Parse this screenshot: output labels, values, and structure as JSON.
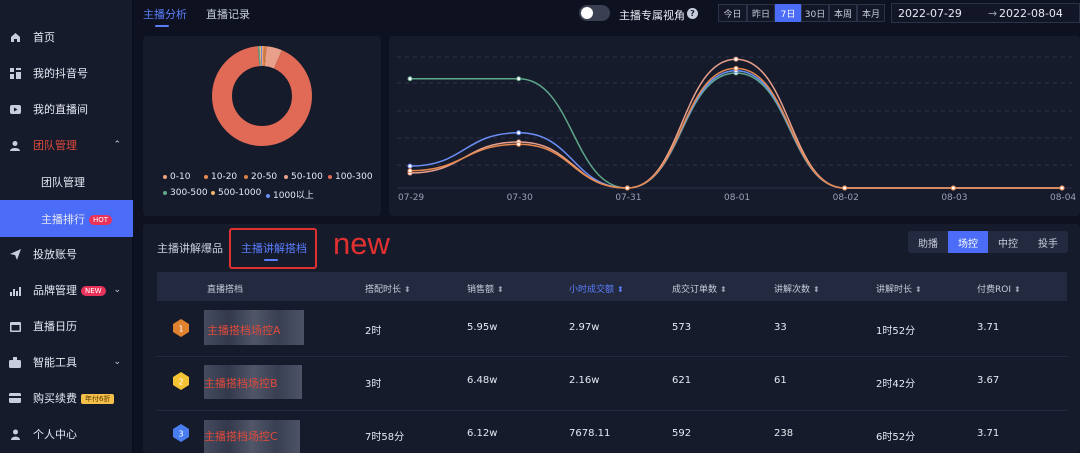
{
  "sidebar": {
    "items": [
      {
        "label": "首页",
        "icon": "home-icon"
      },
      {
        "label": "我的抖音号",
        "icon": "grid-icon"
      },
      {
        "label": "我的直播间",
        "icon": "play-icon"
      },
      {
        "label": "团队管理",
        "icon": "team-icon",
        "chevron": "⌃"
      },
      {
        "label": "投放账号",
        "icon": "send-icon"
      },
      {
        "label": "品牌管理",
        "icon": "bar-chart-icon",
        "badge": "NEW",
        "chevron": "⌄"
      },
      {
        "label": "直播日历",
        "icon": "calendar-icon"
      },
      {
        "label": "智能工具",
        "icon": "tool-icon",
        "chevron": "⌄"
      },
      {
        "label": "购买续费",
        "icon": "card-icon",
        "badge": "年付6折"
      },
      {
        "label": "个人中心",
        "icon": "user-icon"
      }
    ],
    "sub_items": [
      {
        "label": "团队管理"
      },
      {
        "label": "主播排行",
        "badge": "HOT"
      }
    ]
  },
  "topbar": {
    "tabs": [
      "主播分析",
      "直播记录"
    ],
    "toggle_label": "主播专属视角",
    "help_icon": "?",
    "date_buttons": [
      "今日",
      "昨日",
      "7日",
      "30日",
      "本周",
      "本月"
    ],
    "active_date": "7日",
    "date_start": "2022-07-29",
    "date_arrow": "→",
    "date_end": "2022-08-04"
  },
  "colors": {
    "accent": "#4a6cf7",
    "hot_badge": "#e8325a",
    "new_badge": "#e8325a",
    "discount_badge": "#f5c04a",
    "annotation_red": "#e03030"
  },
  "donut": {
    "slices": [
      {
        "label": "0-10",
        "value": 0.5,
        "color": "#f0a37b"
      },
      {
        "label": "10-20",
        "value": 0.5,
        "color": "#e6894f"
      },
      {
        "label": "20-50",
        "value": 0.5,
        "color": "#d97f43"
      },
      {
        "label": "50-100",
        "value": 5,
        "color": "#e8a08a"
      },
      {
        "label": "100-300",
        "value": 92,
        "color": "#e06a55"
      },
      {
        "label": "300-500",
        "value": 0.5,
        "color": "#5fa88a"
      },
      {
        "label": "500-1000",
        "value": 0.5,
        "color": "#f0b46a"
      },
      {
        "label": "1000以上",
        "value": 0.5,
        "color": "#6c8ff5"
      }
    ]
  },
  "chart_data": {
    "type": "line",
    "categories": [
      "07-29",
      "07-30",
      "07-31",
      "08-01",
      "08-02",
      "08-03",
      "08-04"
    ],
    "series": [
      {
        "color": "#5fa88a",
        "values": [
          95,
          95,
          0,
          100,
          0,
          0,
          0
        ]
      },
      {
        "color": "#6c8ff5",
        "values": [
          19,
          48,
          0,
          102,
          0,
          0,
          0
        ]
      },
      {
        "color": "#e8a08a",
        "values": [
          13,
          40,
          0,
          112,
          0,
          0,
          0
        ]
      },
      {
        "color": "#e6894f",
        "values": [
          15,
          38,
          0,
          104,
          0,
          0,
          0
        ]
      }
    ],
    "grid": "dashed horizontal"
  },
  "annotation": {
    "text": "new"
  },
  "table_section": {
    "tabs": [
      "主播讲解爆品",
      "主播讲解搭档"
    ],
    "active_tab": "主播讲解搭档",
    "roles": [
      "助播",
      "场控",
      "中控",
      "投手"
    ],
    "active_role": "场控",
    "headers": [
      "直播搭档",
      "搭配时长",
      "销售额",
      "小时成交额",
      "成交订单数",
      "讲解次数",
      "讲解时长",
      "付费ROI"
    ],
    "sort_icon": "⬍",
    "rows": [
      {
        "rank": "1",
        "name": "主播搭档场控A",
        "duration": "2时",
        "sales": "5.95w",
        "hourly": "2.97w",
        "orders": "573",
        "times": "33",
        "explain": "1时52分",
        "roi": "3.71"
      },
      {
        "rank": "2",
        "name": "主播搭档场控B",
        "duration": "3时",
        "sales": "6.48w",
        "hourly": "2.16w",
        "orders": "621",
        "times": "61",
        "explain": "2时42分",
        "roi": "3.67"
      },
      {
        "rank": "3",
        "name": "主播搭档场控C",
        "duration": "7时58分",
        "sales": "6.12w",
        "hourly": "7678.11",
        "orders": "592",
        "times": "238",
        "explain": "6时52分",
        "roi": "3.71"
      }
    ]
  }
}
